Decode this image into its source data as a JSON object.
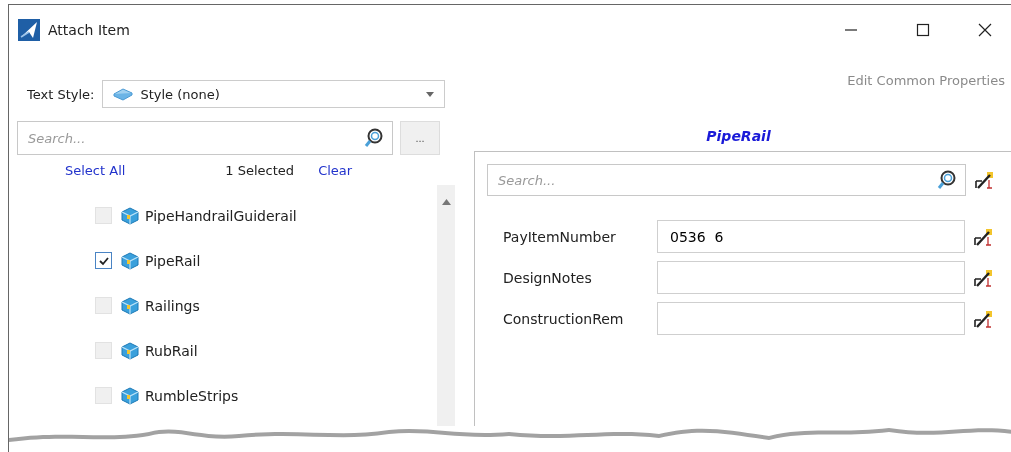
{
  "window": {
    "title": "Attach Item"
  },
  "text_style": {
    "label": "Text Style:",
    "value": "Style (none)"
  },
  "item_search": {
    "placeholder": "Search..."
  },
  "more_button": "...",
  "selection": {
    "select_all": "Select All",
    "count": "1 Selected",
    "clear": "Clear"
  },
  "items": [
    {
      "label": "PipeHandrailGuiderail",
      "checked": false
    },
    {
      "label": "PipeRail",
      "checked": true
    },
    {
      "label": "Railings",
      "checked": false
    },
    {
      "label": "RubRail",
      "checked": false
    },
    {
      "label": "RumbleStrips",
      "checked": false
    }
  ],
  "edit_common_properties": {
    "label": "Edit Common Properties",
    "disabled": true
  },
  "properties": {
    "title": "PipeRail",
    "search": {
      "placeholder": "Search..."
    },
    "fields": [
      {
        "label": "PayItemNumber",
        "value": "0536  6"
      },
      {
        "label": "DesignNotes"
      },
      {
        "label": "ConstructionRem"
      }
    ]
  }
}
